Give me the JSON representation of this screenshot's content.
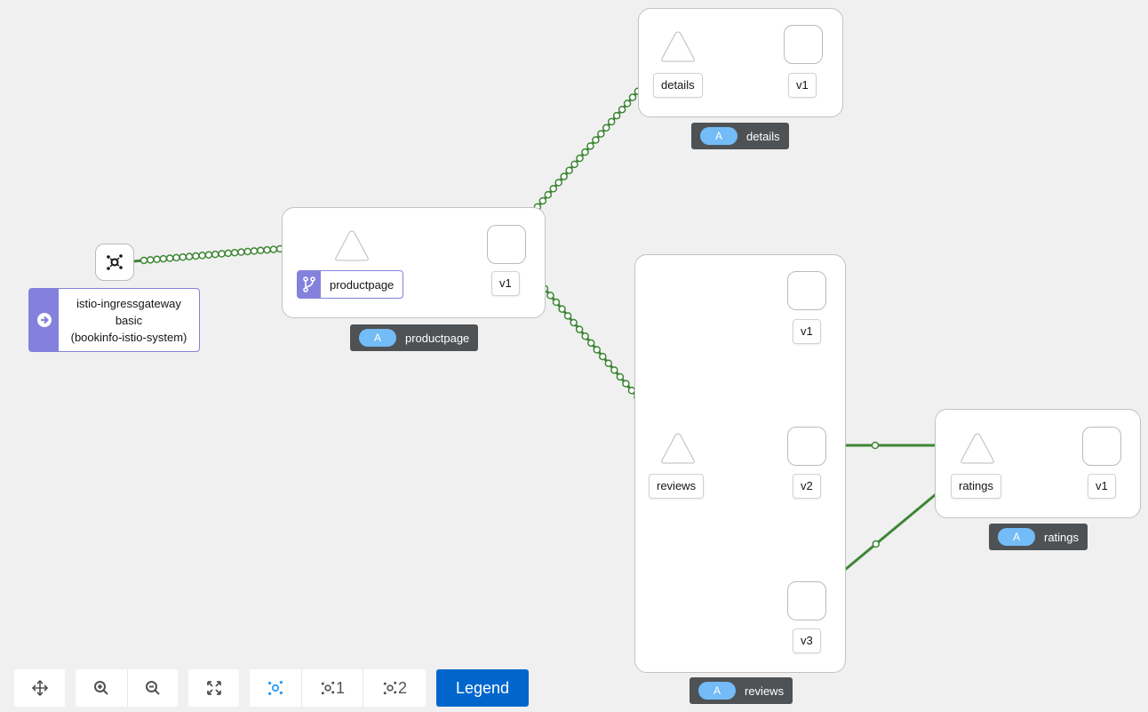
{
  "graph": {
    "edge_color": "#3e8635",
    "app_badge_letter": "A",
    "gateway": {
      "line1": "istio-ingressgateway",
      "line2": "basic",
      "line3": "(bookinfo-istio-system)"
    },
    "productpage": {
      "service_label": "productpage",
      "version_label": "v1",
      "badge": "productpage"
    },
    "details": {
      "service_label": "details",
      "version_label": "v1",
      "badge": "details"
    },
    "reviews": {
      "service_label": "reviews",
      "v1_label": "v1",
      "v2_label": "v2",
      "v3_label": "v3",
      "badge": "reviews"
    },
    "ratings": {
      "service_label": "ratings",
      "version_label": "v1",
      "badge": "ratings"
    }
  },
  "toolbar": {
    "layout_1_label": "1",
    "layout_2_label": "2",
    "legend_label": "Legend"
  }
}
